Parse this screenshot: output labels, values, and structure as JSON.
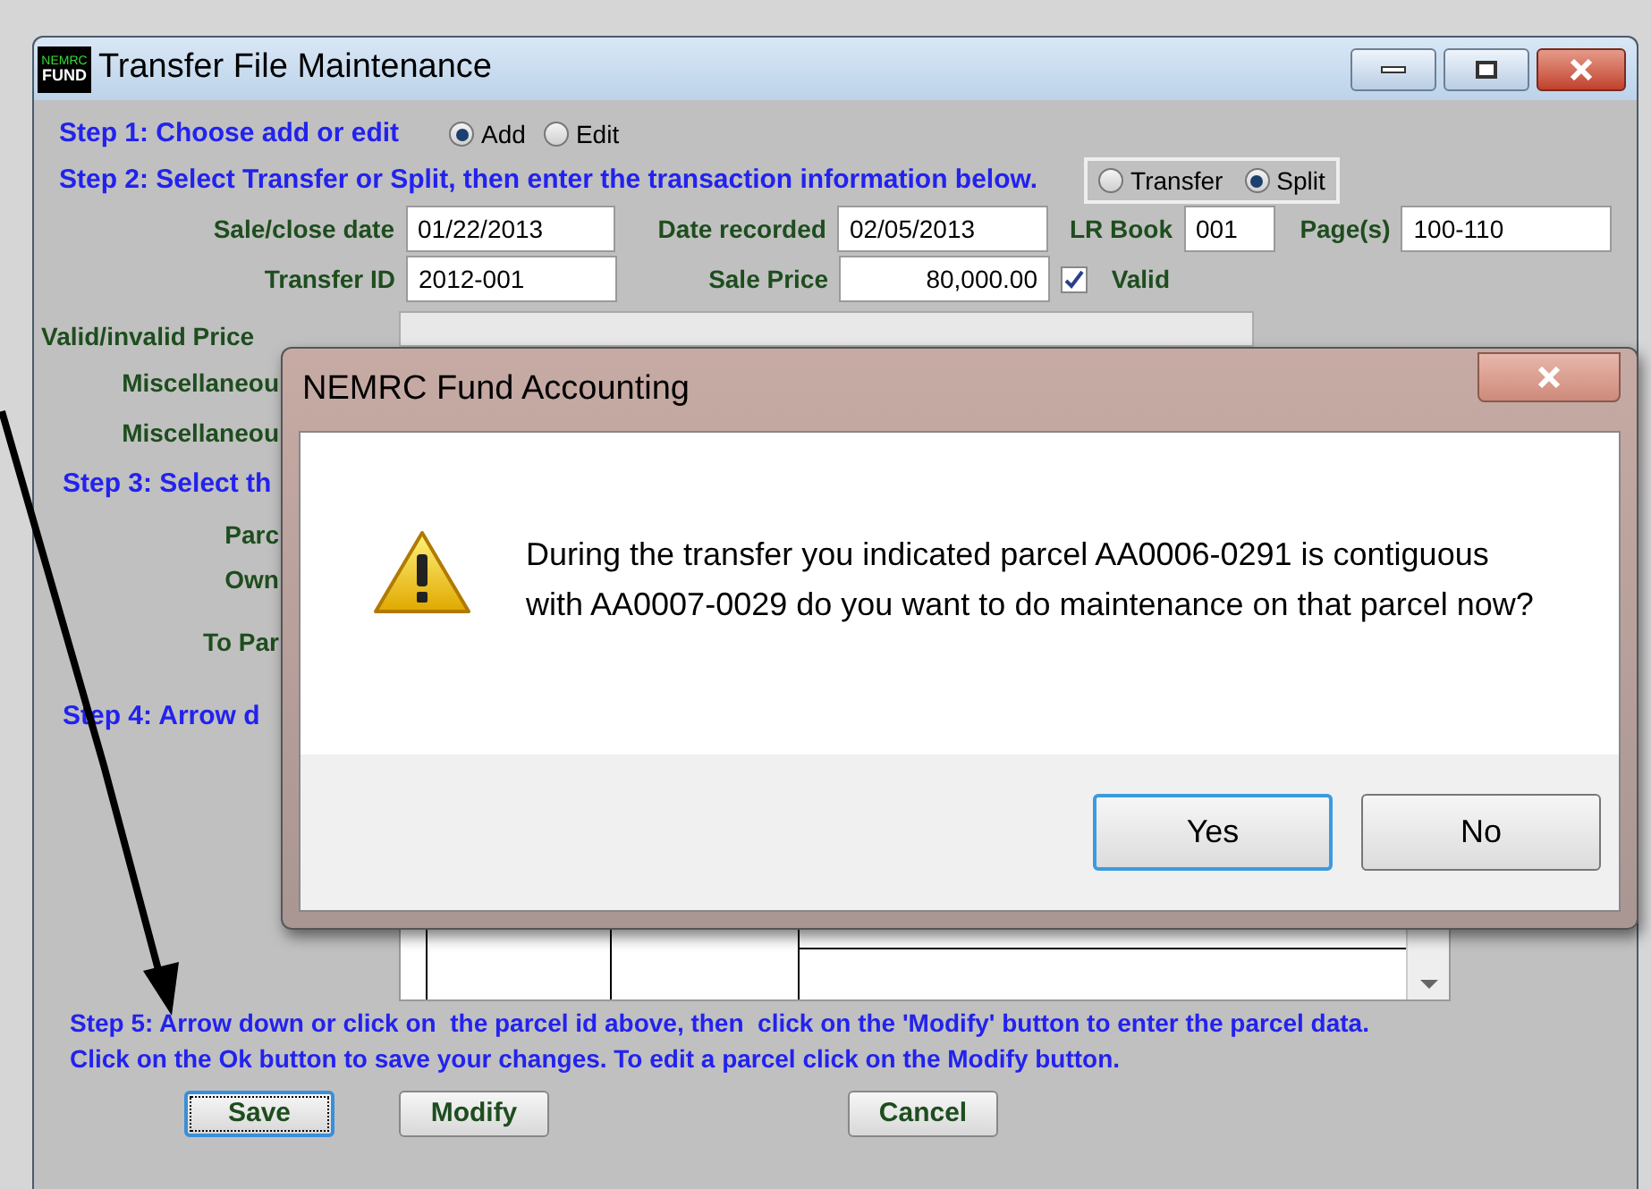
{
  "window": {
    "title": "Transfer File Maintenance",
    "logo_top": "NEMRC",
    "logo_bottom": "FUND"
  },
  "step1": {
    "label": "Step 1: Choose add or edit",
    "options": [
      {
        "label": "Add",
        "selected": true
      },
      {
        "label": "Edit",
        "selected": false
      }
    ]
  },
  "step2": {
    "label": "Step 2: Select Transfer or Split, then enter the transaction information below.",
    "options": [
      {
        "label": "Transfer",
        "selected": false
      },
      {
        "label": "Split",
        "selected": true
      }
    ]
  },
  "fields": {
    "sale_close_date": {
      "label": "Sale/close date",
      "value": "01/22/2013"
    },
    "date_recorded": {
      "label": "Date recorded",
      "value": "02/05/2013"
    },
    "lr_book": {
      "label": "LR Book",
      "value": "001"
    },
    "pages": {
      "label": "Page(s)",
      "value": "100-110"
    },
    "transfer_id": {
      "label": "Transfer ID",
      "value": "2012-001"
    },
    "sale_price": {
      "label": "Sale Price",
      "value": "80,000.00"
    },
    "valid": {
      "label": "Valid",
      "checked": true
    }
  },
  "left_labels": [
    {
      "kind": "field",
      "text": "Valid/invalid Price"
    },
    {
      "kind": "field",
      "text": "Miscellaneou"
    },
    {
      "kind": "field",
      "text": "Miscellaneou"
    },
    {
      "kind": "step",
      "text": "Step 3: Select th"
    },
    {
      "kind": "field",
      "text": "Parc"
    },
    {
      "kind": "field",
      "text": "Own"
    },
    {
      "kind": "field",
      "text": "To Par"
    },
    {
      "kind": "step",
      "text": "Step 4: Arrow d"
    }
  ],
  "step5": [
    "Step 5: Arrow down or click on  the parcel id above, then  click on the 'Modify' button to enter the parcel data.",
    "Click on the Ok button to save your changes. To edit a parcel click on the Modify button."
  ],
  "buttons": [
    {
      "label": "Save",
      "selected": true
    },
    {
      "label": "Modify",
      "selected": false
    },
    {
      "label": "Cancel",
      "selected": false
    }
  ],
  "dialog": {
    "title": "NEMRC Fund Accounting",
    "message": "During the transfer you indicated parcel AA0006-0291 is contiguous with AA0007-0029 do you want to do maintenance on that parcel now?",
    "buttons": [
      {
        "label": "Yes",
        "selected": true
      },
      {
        "label": "No",
        "selected": false
      }
    ]
  }
}
